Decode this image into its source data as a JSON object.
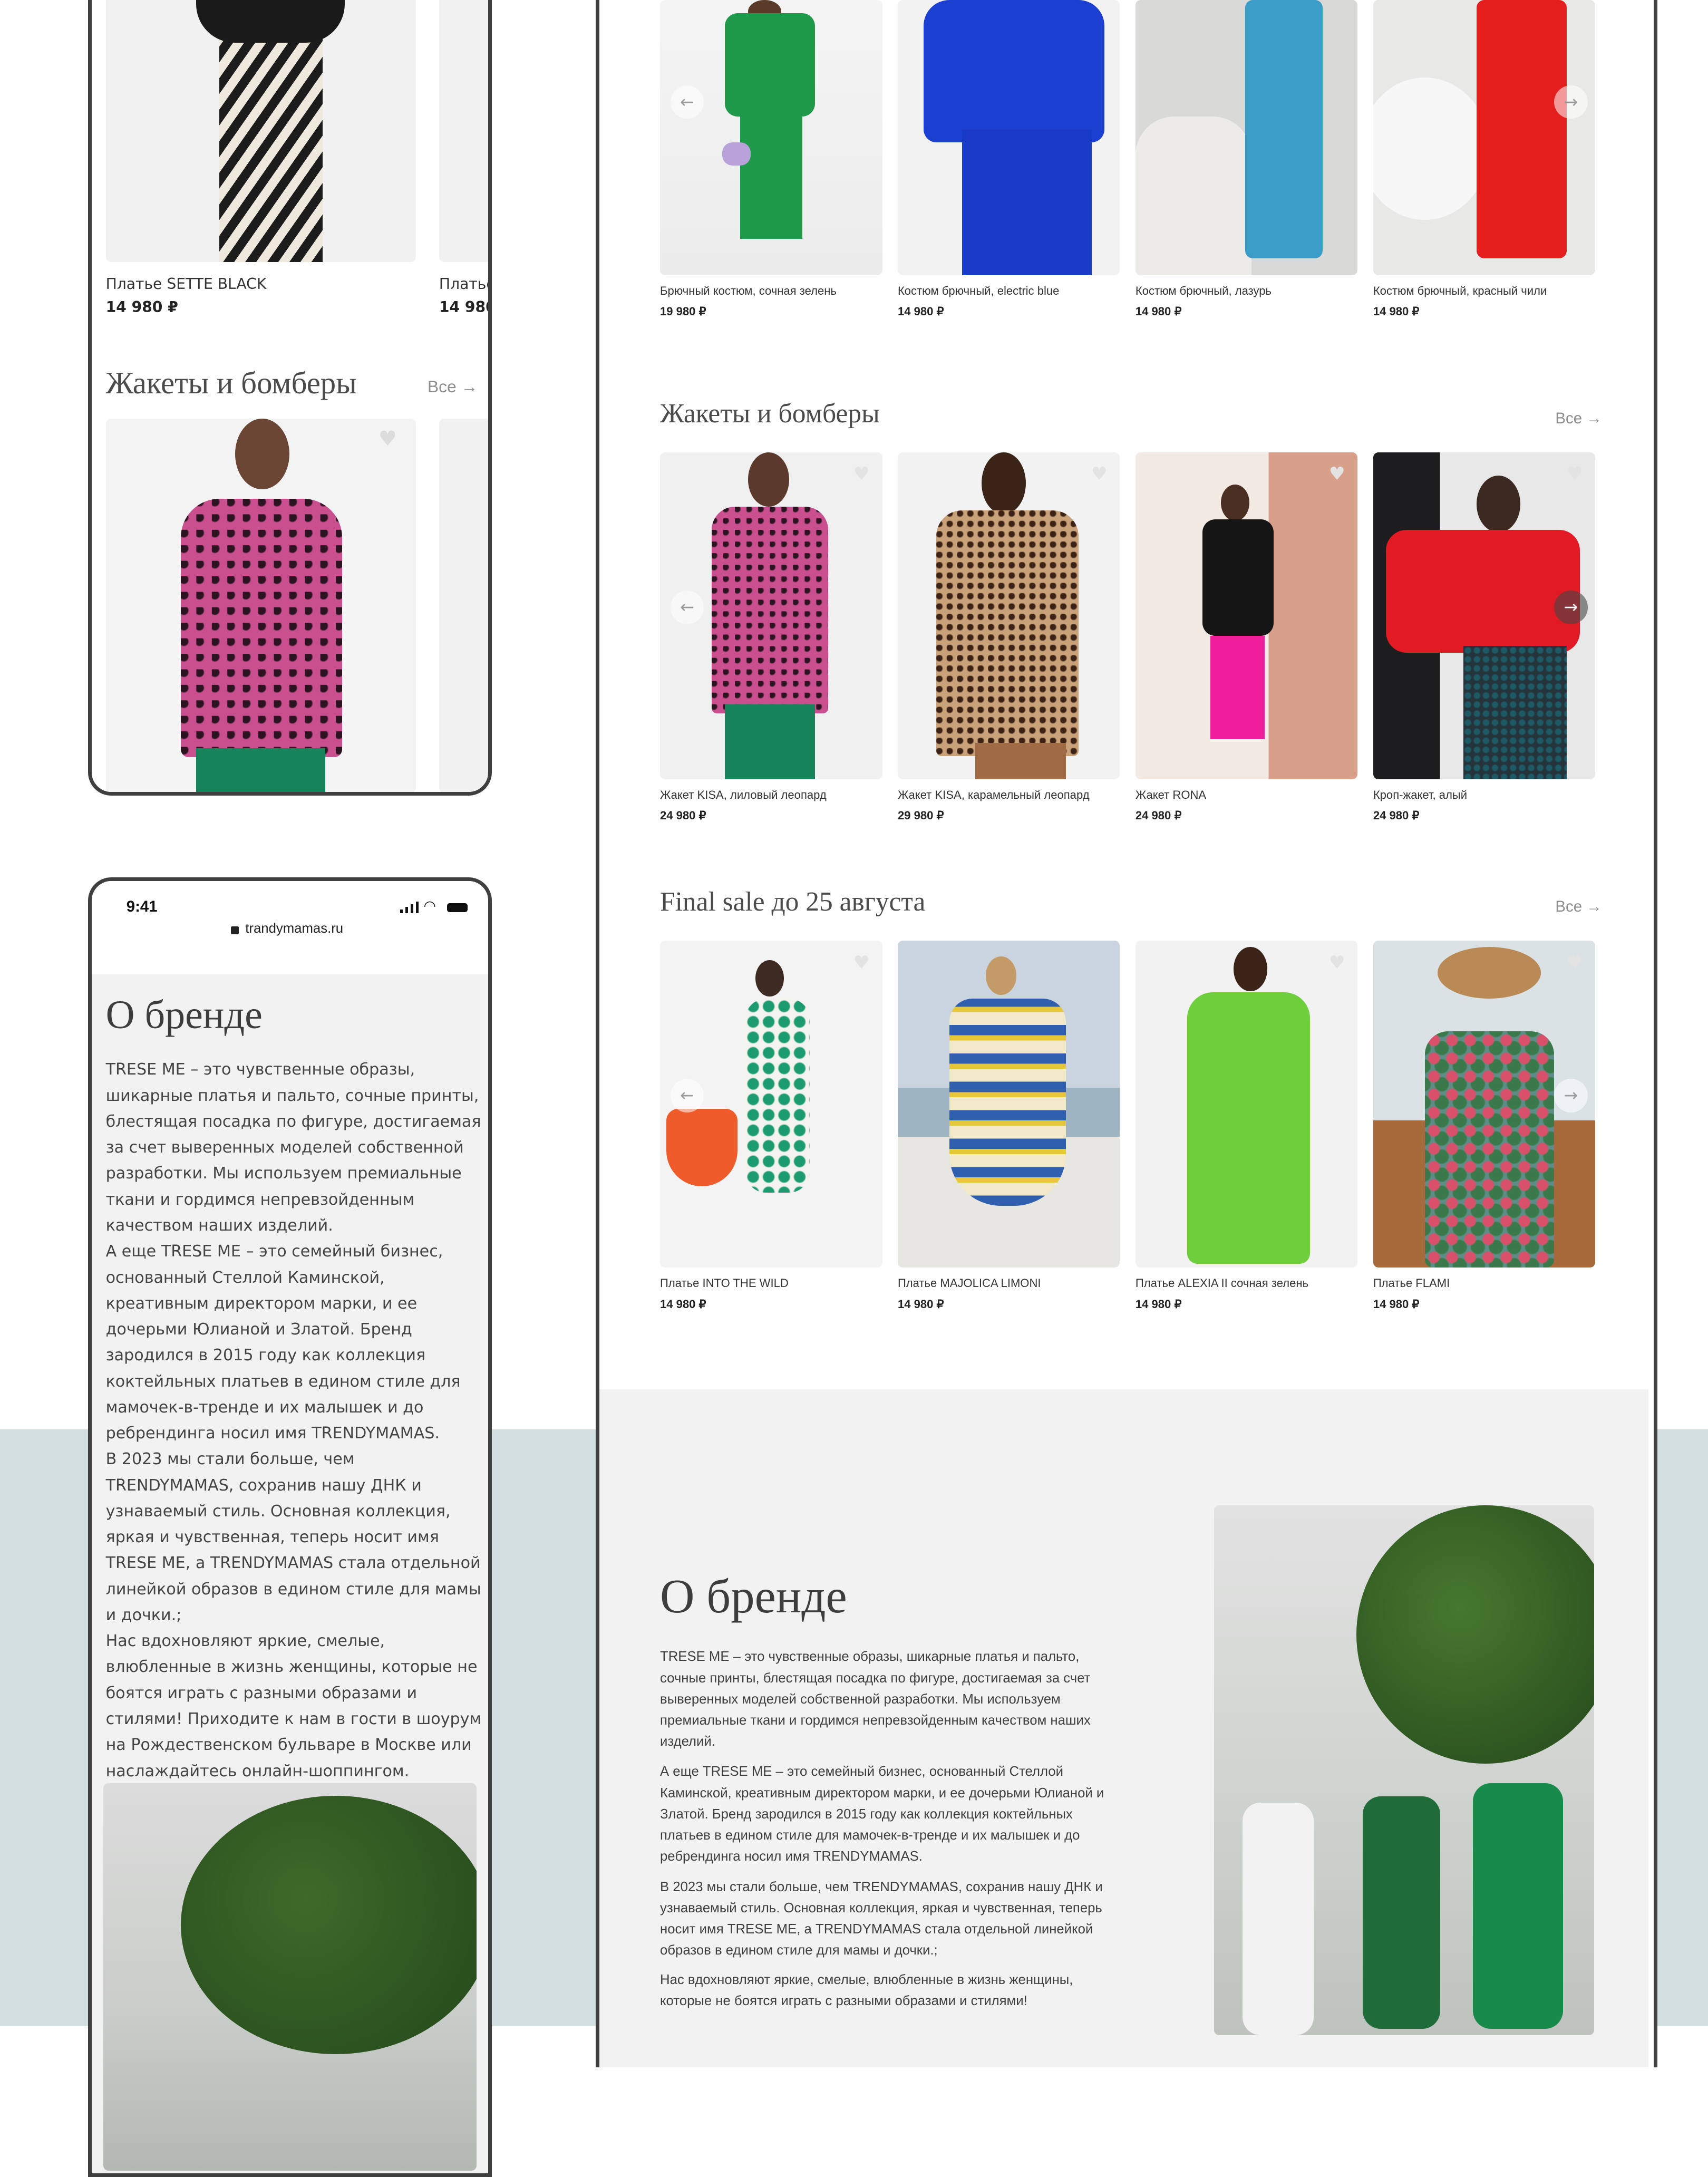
{
  "colors": {
    "frame": "#3f3f3f",
    "bg_band": "#d3dfe0",
    "about_bg": "#f2f2f2",
    "muted": "#8d8d8d"
  },
  "mobile_catalog": {
    "top_product": {
      "name": "Платье SETTE BLACK",
      "price": "14 980 ₽"
    },
    "top_product_peek": {
      "name": "Платье",
      "price": "14 980"
    },
    "section_title": "Жакеты и бомберы",
    "all_label": "Все",
    "arrow_icon": "arrow-right-icon"
  },
  "mobile_about": {
    "status": {
      "time": "9:41",
      "url": "trandymamas.ru"
    },
    "title": "О бренде",
    "text": "TRESE ME – это чувственные образы, шикарные платья и пальто, сочные принты, блестящая посадка по фигуре, достигаемая за счет выверенных моделей собственной разработки. Мы используем премиальные ткани и гордимся непревзойденным качеством наших изделий.\nА еще TRESE ME – это семейный бизнес, основанный Стеллой Каминской, креативным директором марки, и ее дочерьми Юлианой и Златой. Бренд зародился в 2015 году как коллекция коктейльных платьев в едином стиле для мамочек-в-тренде и их малышек и до ребрендинга носил имя TRENDYMAMAS.\nВ 2023 мы стали больше, чем TRENDYMAMAS, сохранив нашу ДНК и узнаваемый стиль. Основная коллекция, яркая и чувственная, теперь носит имя TRESE ME, а TRENDYMAMAS стала отдельной линейкой образов в едином стиле для мамы и дочки.;\nНас вдохновляют яркие, смелые, влюбленные в жизнь женщины, которые не боятся играть с разными образами и стилями! Приходите к нам в гости в шоурум на Рождественском бульваре в Москве или наслаждайтесь онлайн-шоппингом."
  },
  "desktop": {
    "row1": [
      {
        "name": "Брючный костюм, сочная зелень",
        "price": "19 980 ₽"
      },
      {
        "name": "Костюм брючный, electric blue",
        "price": "14 980 ₽"
      },
      {
        "name": "Костюм брючный, лазурь",
        "price": "14 980 ₽"
      },
      {
        "name": "Костюм брючный, красный чили",
        "price": "14 980 ₽"
      }
    ],
    "jackets": {
      "title": "Жакеты и бомберы",
      "all_label": "Все",
      "items": [
        {
          "name": "Жакет KISA, лиловый леопард",
          "price": "24 980 ₽"
        },
        {
          "name": "Жакет KISA, карамельный леопард",
          "price": "29 980 ₽"
        },
        {
          "name": "Жакет RONA",
          "price": "24 980 ₽"
        },
        {
          "name": "Кроп-жакет, алый",
          "price": "24 980 ₽"
        }
      ]
    },
    "sale": {
      "title": "Final sale до 25 августа",
      "all_label": "Все",
      "items": [
        {
          "name": "Платье INTO THE WILD",
          "price": "14 980 ₽"
        },
        {
          "name": "Платье MAJOLICA LIMONI",
          "price": "14 980 ₽"
        },
        {
          "name": "Платье ALEXIA II сочная зелень",
          "price": "14 980 ₽"
        },
        {
          "name": "Платье FLAMI",
          "price": "14 980 ₽"
        }
      ]
    },
    "about": {
      "title": "О бренде",
      "paragraphs": [
        "TRESE ME – это чувственные образы, шикарные платья и пальто, сочные принты, блестящая посадка по фигуре, достигаемая за счет выверенных моделей собственной разработки. Мы используем премиальные ткани и гордимся непревзойденным качеством наших изделий.",
        "А еще TRESE ME – это семейный бизнес, основанный Стеллой Каминской, креативным директором марки, и ее дочерьми Юлианой и Златой. Бренд зародился в 2015 году как коллекция коктейльных платьев в едином стиле для мамочек-в-тренде и их малышек и до ребрендинга носил имя TRENDYMAMAS.",
        "В 2023 мы стали больше, чем TRENDYMAMAS, сохранив нашу ДНК и узнаваемый стиль. Основная коллекция, яркая и чувственная, теперь носит имя TRESE ME, а TRENDYMAMAS стала отдельной линейкой образов в едином стиле для мамы и дочки.;",
        "Нас вдохновляют яркие, смелые, влюбленные в жизнь женщины, которые не боятся играть с разными образами и стилями!"
      ]
    }
  }
}
